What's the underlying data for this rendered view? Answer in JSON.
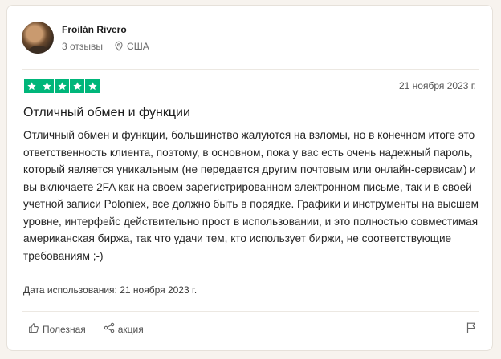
{
  "reviewer": {
    "name": "Froilán Rivero",
    "reviews_count": "3 отзывы",
    "location": "США"
  },
  "rating": {
    "stars": 5,
    "max": 5,
    "color": "#00b67a"
  },
  "review": {
    "date": "21 ноября 2023 г.",
    "title": "Отличный обмен и функции",
    "body": "Отличный обмен и функции, большинство жалуются на взломы, но в конечном итоге это ответственность клиента, поэтому, в основном, пока у вас есть очень надежный пароль, который является уникальным (не передается другим почтовым или онлайн-сервисам) и вы включаете 2FA как на своем зарегистрированном электронном письме, так и в своей учетной записи Poloniex, все должно быть в порядке. Графики и инструменты на высшем уровне, интерфейс действительно прост в использовании, и это полностью совместимая американская биржа, так что удачи тем, кто использует биржи, не соответствующие требованиям ;-)",
    "experience_label": "Дата использования:",
    "experience_date": "21 ноября 2023 г."
  },
  "actions": {
    "useful_label": "Полезная",
    "share_label": "акция"
  },
  "icons": {
    "location": "location-pin-icon",
    "star": "star-icon",
    "useful": "thumbs-up-icon",
    "share": "share-icon",
    "report": "flag-icon"
  }
}
